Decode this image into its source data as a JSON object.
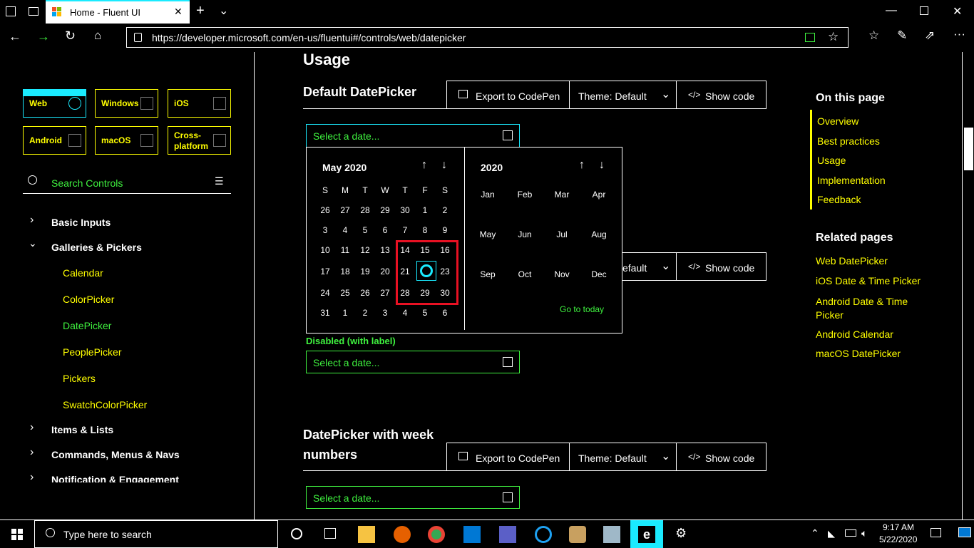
{
  "browser": {
    "tab_title": "Home - Fluent UI",
    "url": "https://developer.microsoft.com/en-us/fluentui#/controls/web/datepicker"
  },
  "sidebar": {
    "platforms": [
      {
        "label": "Web",
        "icon": "globe-icon"
      },
      {
        "label": "Windows",
        "icon": "windows-icon"
      },
      {
        "label": "iOS",
        "icon": "ios-icon"
      },
      {
        "label": "Android",
        "icon": "android-icon"
      },
      {
        "label": "macOS",
        "icon": "macos-icon"
      },
      {
        "label": "Cross-platform",
        "icon": "cross-platform-icon"
      }
    ],
    "search_placeholder": "Search Controls",
    "groups": [
      {
        "label": "Basic Inputs",
        "expanded": false
      },
      {
        "label": "Galleries & Pickers",
        "expanded": true
      },
      {
        "label": "Items & Lists",
        "expanded": false
      },
      {
        "label": "Commands, Menus & Navs",
        "expanded": false
      },
      {
        "label": "Notification & Engagement",
        "expanded": false
      }
    ],
    "subitems": [
      "Calendar",
      "ColorPicker",
      "DatePicker",
      "PeoplePicker",
      "Pickers",
      "SwatchColorPicker"
    ],
    "selected_subitem": "DatePicker"
  },
  "main": {
    "usage_heading": "Usage",
    "section1_title": "Default DatePicker",
    "export_label": "Export to CodePen",
    "theme_label": "Theme: Default",
    "theme_label_partial": "efault",
    "show_code_label": "Show code",
    "date_placeholder": "Select a date...",
    "disabled_label": "Disabled (with label)",
    "section3_title_line1": "DatePicker with week",
    "section3_title_line2": "numbers"
  },
  "calendar": {
    "month_title": "May 2020",
    "year_title": "2020",
    "weekdays": [
      "S",
      "M",
      "T",
      "W",
      "T",
      "F",
      "S"
    ],
    "weeks": [
      [
        "26",
        "27",
        "28",
        "29",
        "30",
        "1",
        "2"
      ],
      [
        "3",
        "4",
        "5",
        "6",
        "7",
        "8",
        "9"
      ],
      [
        "10",
        "11",
        "12",
        "13",
        "14",
        "15",
        "16"
      ],
      [
        "17",
        "18",
        "19",
        "20",
        "21",
        "22",
        "23"
      ],
      [
        "24",
        "25",
        "26",
        "27",
        "28",
        "29",
        "30"
      ],
      [
        "31",
        "1",
        "2",
        "3",
        "4",
        "5",
        "6"
      ]
    ],
    "selected_day": "22",
    "months": [
      "Jan",
      "Feb",
      "Mar",
      "Apr",
      "May",
      "Jun",
      "Jul",
      "Aug",
      "Sep",
      "Oct",
      "Nov",
      "Dec"
    ],
    "go_to_today": "Go to today",
    "highlight_color": "#e81123",
    "accent_color": "#1aebff"
  },
  "on_this_page": {
    "heading": "On this page",
    "items": [
      "Overview",
      "Best practices",
      "Usage",
      "Implementation",
      "Feedback"
    ]
  },
  "related": {
    "heading": "Related pages",
    "items": [
      "Web DatePicker",
      "iOS Date & Time Picker",
      "Android Date & Time Picker",
      "Android Calendar",
      "macOS DatePicker"
    ]
  },
  "taskbar": {
    "search_placeholder": "Type here to search",
    "time": "9:17 AM",
    "date": "5/22/2020"
  },
  "colors": {
    "link_yellow": "#ffff00",
    "link_green": "#3ff23f",
    "accent_cyan": "#1aebff"
  }
}
